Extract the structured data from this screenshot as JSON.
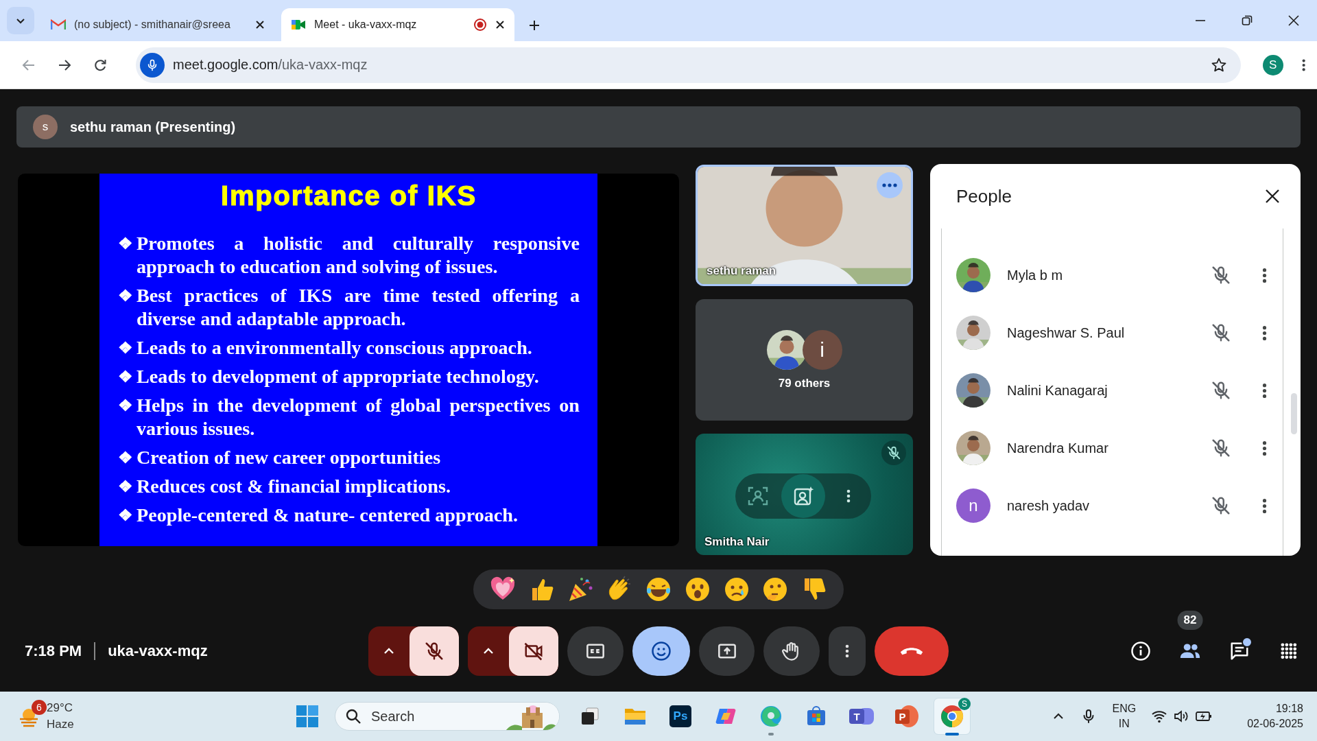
{
  "browser": {
    "tabs": [
      {
        "kind": "mail",
        "title": "(no subject) - smithanair@sreea",
        "selected": false,
        "recording": false
      },
      {
        "kind": "meet",
        "title": "Meet - uka-vaxx-mqz",
        "selected": true,
        "recording": true
      }
    ],
    "url_host": "meet.google.com",
    "url_path": "/uka-vaxx-mqz",
    "profile_initial": "S"
  },
  "presenter_bar": {
    "avatar_initial": "s",
    "text": "sethu raman (Presenting)"
  },
  "slide": {
    "title": "Importance of IKS",
    "marker": "❖",
    "bullets": [
      "Promotes a holistic and culturally responsive approach to education and solving of issues.",
      "Best practices of IKS are time tested offering a diverse and adaptable approach.",
      "Leads to a environmentally conscious approach.",
      "Leads to development of appropriate technology.",
      "Helps in the development of global perspectives on various issues.",
      "Creation of new career opportunities",
      "Reduces cost & financial implications.",
      "People-centered & nature- centered approach."
    ]
  },
  "tiles": [
    {
      "kind": "video",
      "name": "sethu raman",
      "active": true
    },
    {
      "kind": "others",
      "label": "79 others",
      "avatar_initial": "i"
    },
    {
      "kind": "self",
      "name": "Smitha Nair",
      "muted": true
    }
  ],
  "people": {
    "title": "People",
    "participants": [
      {
        "name": "Myla b m",
        "muted": true
      },
      {
        "name": "Nageshwar S. Paul",
        "muted": true
      },
      {
        "name": "Nalini Kanagaraj",
        "muted": true
      },
      {
        "name": "Narendra Kumar",
        "muted": true
      },
      {
        "name": "naresh yadav",
        "kind": "letter",
        "initial": "n",
        "color": "#8e5ccf",
        "muted": true
      }
    ]
  },
  "meeting": {
    "time": "7:18 PM",
    "code": "uka-vaxx-mqz"
  },
  "controls": {
    "mic_on": false,
    "camera_on": false,
    "reactions_open": true,
    "participant_count": "82",
    "chat_unread": true
  },
  "taskbar": {
    "weather_badge": "6",
    "temperature": "29°C",
    "condition": "Haze",
    "search_placeholder": "Search",
    "apps": [
      {
        "kind": "taskview",
        "selected": false,
        "running": false
      },
      {
        "kind": "explorer",
        "selected": false,
        "running": false
      },
      {
        "kind": "photoshop",
        "label": "Ps",
        "selected": false,
        "running": false
      },
      {
        "kind": "copilot",
        "selected": false,
        "running": false
      },
      {
        "kind": "edge",
        "selected": false,
        "running": true
      },
      {
        "kind": "store",
        "selected": false,
        "running": false
      },
      {
        "kind": "teams",
        "label": "T",
        "selected": false,
        "running": false
      },
      {
        "kind": "powerpoint",
        "label": "P",
        "selected": false,
        "running": false
      },
      {
        "kind": "chrome",
        "badge": "S",
        "selected": true,
        "running": true
      }
    ],
    "lang": "ENG",
    "region": "IN",
    "time": "19:18",
    "date": "02-06-2025"
  }
}
